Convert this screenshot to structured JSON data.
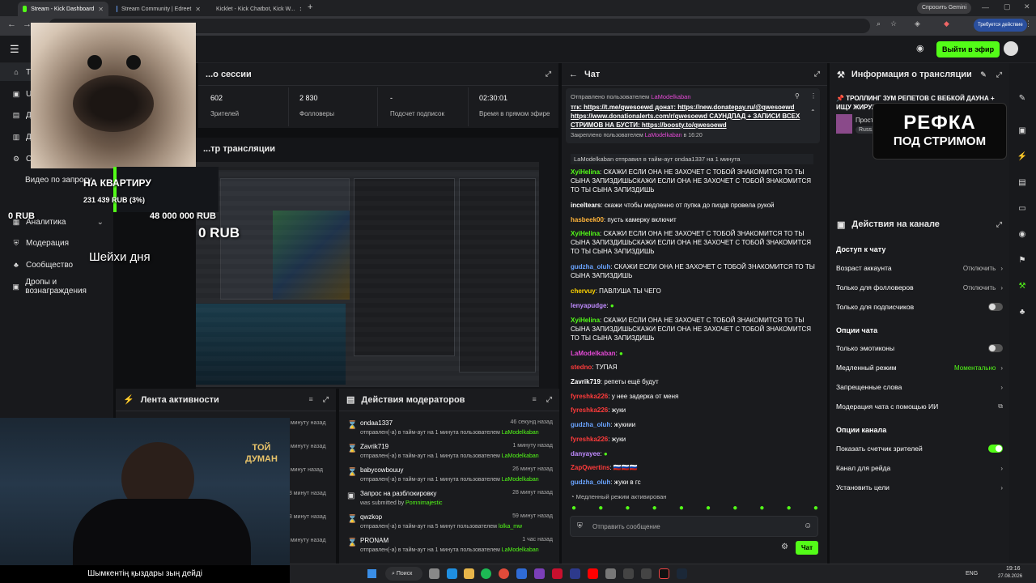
{
  "browser": {
    "tabs": [
      {
        "title": "Stream - Kick Dashboard",
        "active": true,
        "favicon_color": "#53fc18"
      },
      {
        "title": "Stream Community | Edreet",
        "active": false,
        "favicon_color": "#6aa4ff"
      },
      {
        "title": "Kicklet - Kick Chatbot, Kick W...",
        "active": false,
        "favicon_color": "#53fc18"
      }
    ],
    "gemini_label": "Спросить Gemini",
    "update_label": "Требуется действие"
  },
  "header": {
    "go_live_label": "Выйти в эфир"
  },
  "nav": {
    "items": [
      {
        "label": "Тр...",
        "icon": "home-icon"
      },
      {
        "label": "UI",
        "icon": "ui-icon"
      },
      {
        "label": "Д...",
        "icon": "dashboard-icon"
      },
      {
        "label": "Д...",
        "icon": "doc-icon"
      },
      {
        "label": "С...",
        "icon": "settings-icon"
      },
      {
        "label": "Видео по запросу",
        "icon": ""
      },
      {
        "label": "Аналитика",
        "icon": "chart-icon"
      },
      {
        "label": "Модерация",
        "icon": "shield-icon"
      },
      {
        "label": "Сообщество",
        "icon": "community-icon"
      },
      {
        "label": "Дропы и вознаграждения",
        "icon": "gift-icon"
      }
    ]
  },
  "session": {
    "title": "...о сессии",
    "stats": [
      {
        "value": "602",
        "label": "Зрителей"
      },
      {
        "value": "2 830",
        "label": "Фолловеры"
      },
      {
        "value": "-",
        "label": "Подсчет подписок"
      },
      {
        "value": "02:30:01",
        "label": "Время в прямом эфире"
      }
    ]
  },
  "preview": {
    "title": "...тр трансляции"
  },
  "overlay": {
    "goal_title": "НА КВАРТИРУ",
    "goal_progress": "231 439 RUB (3%)",
    "goal_fraction": 0.03,
    "rub_left": "0 RUB",
    "rub_big": "48 000 000 RUB",
    "rub_mid": "0 RUB",
    "day_label": "Шейхи дня",
    "video_caption": "Шымкентің қыздары зың дейді",
    "refka_line1": "РЕФКА",
    "refka_line2": "ПОД СТРИМОМ",
    "toy_logo": "ТОЙ ДУМАН"
  },
  "activity": {
    "title": "Лента активности",
    "times": [
      "1 минуту назад",
      "1 минуту назад",
      "8 минут назад",
      "13 минут назад",
      "18 минут назад",
      "1 минуту назад"
    ]
  },
  "mod_actions": {
    "title": "Действия модераторов",
    "items": [
      {
        "name": "ondaa1337",
        "time": "46 секунд назад",
        "desc": "отправлен(-а) в тайм-аут на 1 минута пользователем",
        "by": "LaModelkaban",
        "icon": "hourglass-icon"
      },
      {
        "name": "Zavrik719",
        "time": "1 минуту назад",
        "desc": "отправлен(-а) в тайм-аут на 1 минута пользователем",
        "by": "LaModelkaban",
        "icon": "hourglass-icon"
      },
      {
        "name": "babycowbouuy",
        "time": "26 минут назад",
        "desc": "отправлен(-а) в тайм-аут на 1 минута пользователем",
        "by": "LaModelkaban",
        "icon": "hourglass-icon"
      },
      {
        "name": "Запрос на разблокировку",
        "time": "28 минут назад",
        "desc": "was submitted by",
        "by": "Pomnimajestic",
        "icon": "unban-icon"
      },
      {
        "name": "qwzkop",
        "time": "59 минут назад",
        "desc": "отправлен(-а) в тайм-аут на 5 минут пользователем",
        "by": "lolka_mw",
        "icon": "hourglass-icon"
      },
      {
        "name": "PRONAM",
        "time": "1 час назад",
        "desc": "отправлен(-а) в тайм-аут на 1 минута пользователем",
        "by": "LaModelkaban",
        "icon": "hourglass-icon"
      }
    ]
  },
  "chat": {
    "title": "Чат",
    "pinned_by_label": "Отправлено пользователем",
    "pinned_user": "LaModelkaban",
    "pinned_text": "тгк: https://t.me/qwesoewd донат: https://new.donatepay.ru/@qwesoewd https://www.donationalerts.com/r/qwesoewd САУНДПАД + ЗАПИСИ ВСЕХ СТРИМОВ НА БУСТИ: https://boosty.to/qwesoewd",
    "pinned_footer": "Закреплено пользователем",
    "pinned_footer_user": "LaModelkaban",
    "pinned_footer_time": "в 16:20",
    "system_line": "LaModelkaban отправил в тайм-аут ondaa1337 на 1 минута",
    "messages": [
      {
        "user": "XyiHelina",
        "color": "#53fc18",
        "text": "СКАЖИ ЕСЛИ ОНА НЕ ЗАХОЧЕТ С ТОБОЙ ЗНАКОМИТСЯ ТО ТЫ СЫНА ЗАПИЗДИШЬСКАЖИ ЕСЛИ ОНА НЕ ЗАХОЧЕТ С ТОБОЙ ЗНАКОМИТСЯ ТО ТЫ СЫНА ЗАПИЗДИШЬ"
      },
      {
        "user": "inceltears",
        "color": "#ffffff",
        "text": "скажи чтобы медленно от пупка до пиздв провела рукой"
      },
      {
        "user": "hasbeek00",
        "color": "#ffb43a",
        "text": "пусть камерку включит"
      },
      {
        "user": "XyiHelina",
        "color": "#53fc18",
        "text": "СКАЖИ ЕСЛИ ОНА НЕ ЗАХОЧЕТ С ТОБОЙ ЗНАКОМИТСЯ ТО ТЫ СЫНА ЗАПИЗДИШЬСКАЖИ ЕСЛИ ОНА НЕ ЗАХОЧЕТ С ТОБОЙ ЗНАКОМИТСЯ ТО ТЫ СЫНА ЗАПИЗДИШЬ"
      },
      {
        "user": "gudzha_oluh",
        "color": "#6aa4ff",
        "text": "СКАЖИ ЕСЛИ ОНА НЕ ЗАХОЧЕТ С ТОБОЙ ЗНАКОМИТСЯ ТО ТЫ СЫНА ЗАПИЗДИШЬ"
      },
      {
        "user": "chervuy",
        "color": "#ffd400",
        "text": "ПАВЛУША ТЫ ЧЕГО"
      },
      {
        "user": "lenyapudge",
        "color": "#c08bff",
        "text": ""
      },
      {
        "user": "XyiHelina",
        "color": "#53fc18",
        "text": "СКАЖИ ЕСЛИ ОНА НЕ ЗАХОЧЕТ С ТОБОЙ ЗНАКОМИТСЯ ТО ТЫ СЫНА ЗАПИЗДИШЬСКАЖИ ЕСЛИ ОНА НЕ ЗАХОЧЕТ С ТОБОЙ ЗНАКОМИТСЯ ТО ТЫ СЫНА ЗАПИЗДИШЬ"
      },
      {
        "user": "LaModelkaban",
        "color": "#e54ad6",
        "text": ""
      },
      {
        "user": "stedno",
        "color": "#ff3b3b",
        "text": "ТУПАЯ"
      },
      {
        "user": "Zavrik719",
        "color": "#ffffff",
        "text": "репеты ещё будут"
      },
      {
        "user": "fyreshka226",
        "color": "#ff3b3b",
        "text": "у нее задерка от меня"
      },
      {
        "user": "fyreshka226",
        "color": "#ff3b3b",
        "text": "жуки"
      },
      {
        "user": "gudzha_oluh",
        "color": "#6aa4ff",
        "text": "жукиии"
      },
      {
        "user": "fyreshka226",
        "color": "#ff3b3b",
        "text": "жуки"
      },
      {
        "user": "danyayee",
        "color": "#c08bff",
        "text": ""
      },
      {
        "user": "ZapQwertins",
        "color": "#ff3b3b",
        "text": "🇷🇺🇷🇺🇷🇺"
      },
      {
        "user": "gudzha_oluh",
        "color": "#6aa4ff",
        "text": "жуки в гс"
      }
    ],
    "slow_mode_notice": "Медленный режим активирован",
    "input_placeholder": "Отправить сообщение",
    "send_label": "Чат"
  },
  "stream_info": {
    "title": "Информация о трансляции",
    "stream_title": "ТРОЛЛИНГ ЗУМ РЕПЕТОВ С ВЕБКОЙ ДАУНА + ИЩУ ЖИРУЛ...",
    "category": "Прост...",
    "language": "Russ..."
  },
  "channel_actions": {
    "title": "Действия на канале",
    "sections": [
      {
        "title": "Доступ к чату",
        "rows": [
          {
            "label": "Возраст аккаунта",
            "value": "Отключить",
            "kind": "link"
          },
          {
            "label": "Только для фолловеров",
            "value": "Отключить",
            "kind": "link"
          },
          {
            "label": "Только для подписчиков",
            "value": "",
            "kind": "toggle",
            "on": false
          }
        ]
      },
      {
        "title": "Опции чата",
        "rows": [
          {
            "label": "Только эмотиконы",
            "value": "",
            "kind": "toggle",
            "on": false
          },
          {
            "label": "Медленный режим",
            "value": "Моментально",
            "kind": "link"
          },
          {
            "label": "Запрещенные слова",
            "value": "",
            "kind": "link"
          },
          {
            "label": "Модерация чата с помощью ИИ",
            "value": "",
            "kind": "external"
          }
        ]
      },
      {
        "title": "Опции канала",
        "rows": [
          {
            "label": "Показать счетчик зрителей",
            "value": "",
            "kind": "toggle",
            "on": true
          },
          {
            "label": "Канал для рейда",
            "value": "",
            "kind": "link"
          },
          {
            "label": "Установить цели",
            "value": "",
            "kind": "link"
          }
        ]
      }
    ]
  },
  "taskbar": {
    "search_label": "Поиск",
    "lang": "ENG",
    "time": "19:16",
    "date": "27.08.2026"
  },
  "colors": {
    "accent": "#53fc18",
    "panel": "#1a1b1e",
    "bg": "#0e0f11"
  }
}
